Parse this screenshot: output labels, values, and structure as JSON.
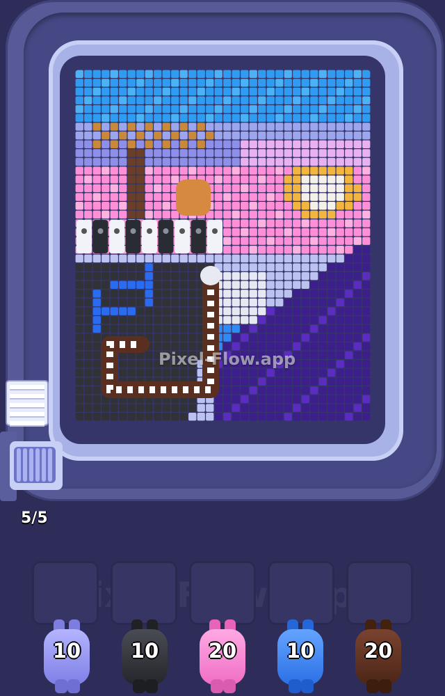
{
  "watermark": "Pixel-Flow.app",
  "progress": {
    "text": "5/5",
    "filled": 5,
    "total": 5
  },
  "colors": {
    "periwinkle": "#8f8ff2",
    "black": "#303238",
    "pink": "#ff7fd1",
    "blue": "#2f7cf0",
    "brown": "#5a2f1f"
  },
  "slots": [
    {
      "state": "empty"
    },
    {
      "state": "empty"
    },
    {
      "state": "empty"
    },
    {
      "state": "empty"
    },
    {
      "state": "empty"
    }
  ],
  "pigs": [
    {
      "count": "10",
      "color": "periwinkle"
    },
    {
      "count": "10",
      "color": "black"
    },
    {
      "count": "20",
      "color": "pink"
    },
    {
      "count": "10",
      "color": "blue"
    },
    {
      "count": "20",
      "color": "brown"
    }
  ],
  "board": {
    "columns": 34,
    "rows": 40,
    "palette": [
      "blue sky",
      "purple sky",
      "orange branch",
      "pink cloud",
      "cream sun",
      "black ground",
      "blue stream",
      "purple hill",
      "white snow"
    ]
  }
}
